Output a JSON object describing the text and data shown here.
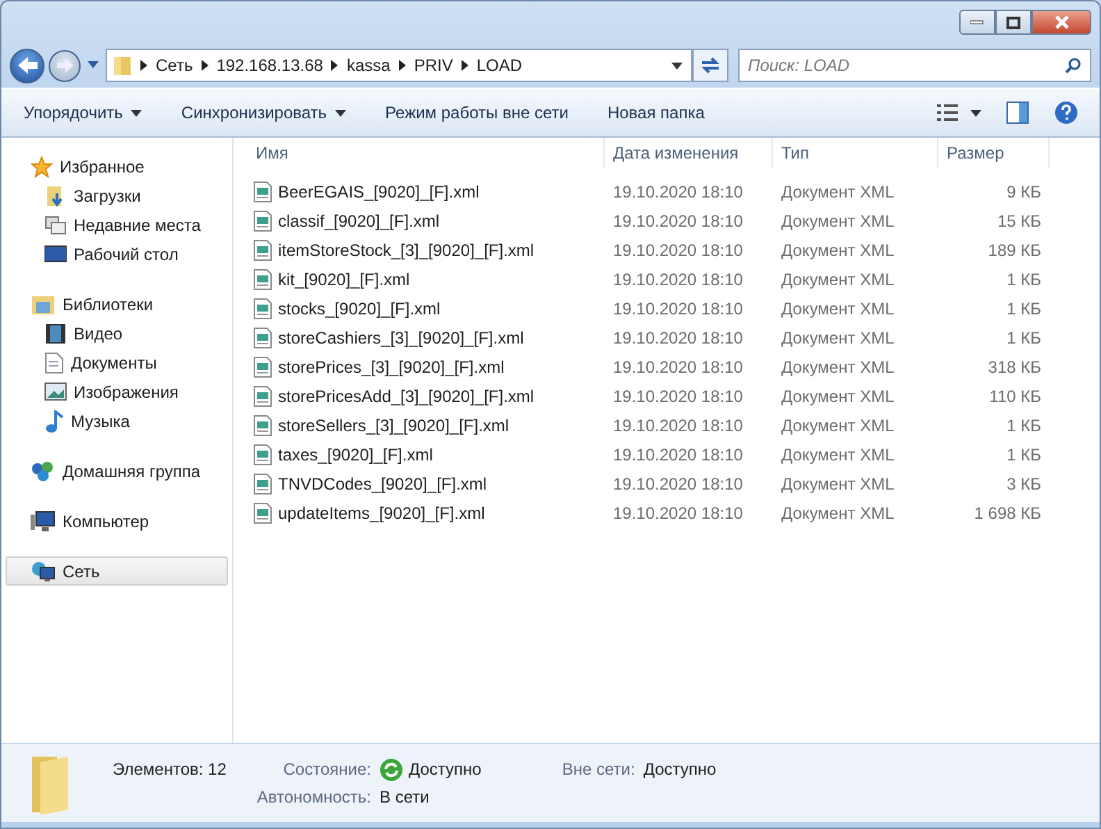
{
  "address": {
    "crumbs": [
      "Сеть",
      "192.168.13.68",
      "kassa",
      "PRIV",
      "LOAD"
    ]
  },
  "search": {
    "placeholder": "Поиск: LOAD"
  },
  "toolbar": [
    {
      "label": "Упорядочить",
      "dropdown": true
    },
    {
      "label": "Синхронизировать",
      "dropdown": true
    },
    {
      "label": "Режим работы вне сети",
      "dropdown": false
    },
    {
      "label": "Новая папка",
      "dropdown": false
    }
  ],
  "sidebar": {
    "groups": [
      {
        "label": "Избранное",
        "kind": "star",
        "selected": false,
        "children": [
          {
            "label": "Загрузки",
            "kind": "downloads",
            "selected": false
          },
          {
            "label": "Недавние места",
            "kind": "recent",
            "selected": false
          },
          {
            "label": "Рабочий стол",
            "kind": "desktop",
            "selected": false
          }
        ]
      },
      {
        "label": "Библиотеки",
        "kind": "library",
        "selected": false,
        "children": [
          {
            "label": "Видео",
            "kind": "video",
            "selected": false
          },
          {
            "label": "Документы",
            "kind": "document",
            "selected": false
          },
          {
            "label": "Изображения",
            "kind": "image",
            "selected": false
          },
          {
            "label": "Музыка",
            "kind": "music",
            "selected": false
          }
        ]
      },
      {
        "label": "Домашняя группа",
        "kind": "homegroup",
        "selected": false
      },
      {
        "label": "Компьютер",
        "kind": "computer",
        "selected": false
      },
      {
        "label": "Сеть",
        "kind": "network",
        "selected": true
      }
    ]
  },
  "table": {
    "columns": [
      "Имя",
      "Дата изменения",
      "Тип",
      "Размер"
    ],
    "rows": [
      {
        "name": "BeerEGAIS_[9020]_[F].xml",
        "date": "19.10.2020 18:10",
        "type": "Документ XML",
        "size": "9 КБ"
      },
      {
        "name": "classif_[9020]_[F].xml",
        "date": "19.10.2020 18:10",
        "type": "Документ XML",
        "size": "15 КБ"
      },
      {
        "name": "itemStoreStock_[3]_[9020]_[F].xml",
        "date": "19.10.2020 18:10",
        "type": "Документ XML",
        "size": "189 КБ"
      },
      {
        "name": "kit_[9020]_[F].xml",
        "date": "19.10.2020 18:10",
        "type": "Документ XML",
        "size": "1 КБ"
      },
      {
        "name": "stocks_[9020]_[F].xml",
        "date": "19.10.2020 18:10",
        "type": "Документ XML",
        "size": "1 КБ"
      },
      {
        "name": "storeCashiers_[3]_[9020]_[F].xml",
        "date": "19.10.2020 18:10",
        "type": "Документ XML",
        "size": "1 КБ"
      },
      {
        "name": "storePrices_[3]_[9020]_[F].xml",
        "date": "19.10.2020 18:10",
        "type": "Документ XML",
        "size": "318 КБ"
      },
      {
        "name": "storePricesAdd_[3]_[9020]_[F].xml",
        "date": "19.10.2020 18:10",
        "type": "Документ XML",
        "size": "110 КБ"
      },
      {
        "name": "storeSellers_[3]_[9020]_[F].xml",
        "date": "19.10.2020 18:10",
        "type": "Документ XML",
        "size": "1 КБ"
      },
      {
        "name": "taxes_[9020]_[F].xml",
        "date": "19.10.2020 18:10",
        "type": "Документ XML",
        "size": "1 КБ"
      },
      {
        "name": "TNVDCodes_[9020]_[F].xml",
        "date": "19.10.2020 18:10",
        "type": "Документ XML",
        "size": "3 КБ"
      },
      {
        "name": "updateItems_[9020]_[F].xml",
        "date": "19.10.2020 18:10",
        "type": "Документ XML",
        "size": "1 698 КБ"
      }
    ]
  },
  "status_bar": {
    "count": "Элементов: 12",
    "fields": [
      {
        "label": "Состояние:",
        "value": "Доступно",
        "kind": "sync"
      },
      {
        "label": "Вне сети:",
        "value": "Доступно",
        "kind": "plain"
      },
      {
        "label": "Автономность:",
        "value": "В сети",
        "kind": "plain"
      }
    ]
  }
}
